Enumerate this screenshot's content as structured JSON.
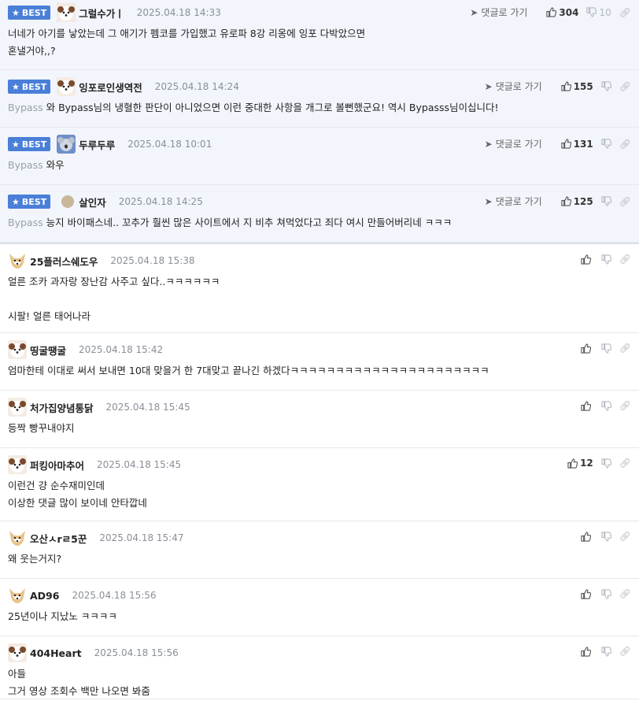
{
  "labels": {
    "best": "BEST",
    "goto": "댓글로 가기"
  },
  "colors": {
    "best_badge": "#4a7fd8",
    "best_bg": "#f2f5fb"
  },
  "best": [
    {
      "nick": "그럴수가ㅣ",
      "date": "2025.04.18 14:33",
      "up": "304",
      "down": "10",
      "prefix": "",
      "text": "너네가 아기를 낳았는데 그 애기가 펨코를 가입했고 유로파 8강 리옹에 잉포 다박았으면\n혼낼거야,,?"
    },
    {
      "nick": "잉포로인생역전",
      "date": "2025.04.18 14:24",
      "up": "155",
      "down": "",
      "prefix": "Bypass",
      "text": "와 Bypass님의 냉혈한 판단이 아니었으면 이런 중대한 사항을 개그로 볼뻔했군요! 역시 Bypasss님이십니다!"
    },
    {
      "nick": "두루두루",
      "date": "2025.04.18 10:01",
      "up": "131",
      "down": "",
      "prefix": "Bypass",
      "text": "와우"
    },
    {
      "nick": "살인자",
      "date": "2025.04.18 14:25",
      "up": "125",
      "down": "",
      "prefix": "Bypass",
      "text": "능지 바이패스네.. 꼬추가 훨씬 많은 사이트에서 지 비추 쳐먹었다고 죄다 여시 만들어버리네 ㅋㅋㅋ"
    }
  ],
  "comments": [
    {
      "nick": "25플러스쉐도우",
      "date": "2025.04.18 15:38",
      "up": "",
      "text": "얼른 조카 과자랑 장난감 사주고 싶다..ㅋㅋㅋㅋㅋㅋ\n\n시팔! 얼른 태어나라"
    },
    {
      "nick": "띵굴땡굴",
      "date": "2025.04.18 15:42",
      "up": "",
      "text": "엄마한테 이대로 써서 보내면 10대 맞을거 한 7대맞고 끝나긴 하겠다ㅋㅋㅋㅋㅋㅋㅋㅋㅋㅋㅋㅋㅋㅋㅋㅋㅋㅋㅋㅋㅋㅋ"
    },
    {
      "nick": "처가집양념통닭",
      "date": "2025.04.18 15:45",
      "up": "",
      "text": "등짝 빵꾸내야지"
    },
    {
      "nick": "퍼킹아마추어",
      "date": "2025.04.18 15:45",
      "up": "12",
      "text": "이런건 걍 순수재미인데\n이상한 댓글 많이 보이네 안타깝네"
    },
    {
      "nick": "오산ㅅrㄹ5꾼",
      "date": "2025.04.18 15:47",
      "up": "",
      "text": "왜 웃는거지?"
    },
    {
      "nick": "AD96",
      "date": "2025.04.18 15:56",
      "up": "",
      "text": "25년이나 지났노 ㅋㅋㅋㅋ"
    },
    {
      "nick": "404Heart",
      "date": "2025.04.18 15:56",
      "up": "",
      "text": "아들\n그거 영상 조회수 백만 나오면 봐줌"
    }
  ]
}
